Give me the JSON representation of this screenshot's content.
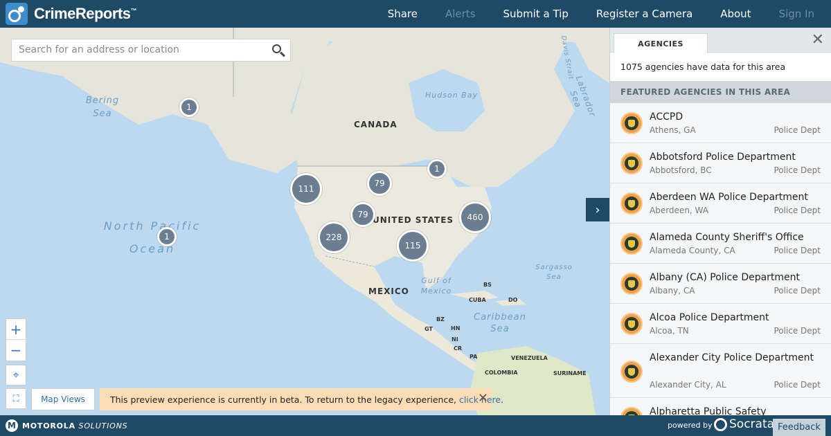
{
  "header": {
    "logo_text": "CrimeReports",
    "logo_tm": "™",
    "nav": [
      {
        "label": "Share",
        "enabled": true
      },
      {
        "label": "Alerts",
        "enabled": false
      },
      {
        "label": "Submit a Tip",
        "enabled": true
      },
      {
        "label": "Register a Camera",
        "enabled": true
      },
      {
        "label": "About",
        "enabled": true
      },
      {
        "label": "Sign In",
        "enabled": false
      }
    ]
  },
  "search": {
    "placeholder": "Search for an address or location"
  },
  "map": {
    "clusters": [
      "1",
      "1",
      "111",
      "79",
      "79",
      "228",
      "115",
      "460",
      "1"
    ],
    "labels": {
      "canada": "CANADA",
      "united_states": "UNITED STATES",
      "mexico": "MEXICO",
      "cuba": "CUBA",
      "bs": "BS",
      "do": "DO",
      "bz": "BZ",
      "gt": "GT",
      "hn": "HN",
      "ni": "NI",
      "cr": "CR",
      "pa": "PA",
      "venezuela": "VENEZUELA",
      "colombia": "COLOMBIA",
      "suriname": "SURINAME"
    },
    "oceans": {
      "north_pacific_1": "North Pacific",
      "north_pacific_2": "Ocean",
      "bering_1": "Bering",
      "bering_2": "Sea",
      "hudson": "Hudson Bay",
      "labrador_1": "Labrador",
      "labrador_2": "Sea",
      "davis": "Davis Strait",
      "gulf_1": "Gulf of",
      "gulf_2": "Mexico",
      "caribbean_1": "Caribbean",
      "caribbean_2": "Sea",
      "sargasso_1": "Sargasso",
      "sargasso_2": "Sea"
    },
    "map_views": "Map Views",
    "zoom_in": "+",
    "zoom_out": "−"
  },
  "beta_notice": {
    "text": "This preview experience is currently in beta. To return to the legacy experience,",
    "link": "click here",
    "period": "."
  },
  "panel": {
    "tab": "AGENCIES",
    "count_text": "1075 agencies have data for this area",
    "featured_header": "FEATURED AGENCIES IN THIS AREA",
    "agencies": [
      {
        "name": "ACCPD",
        "location": "Athens, GA",
        "type": "Police Dept"
      },
      {
        "name": "Abbotsford Police Department",
        "location": "Abbotsford, BC",
        "type": "Police Dept"
      },
      {
        "name": "Aberdeen WA Police Department",
        "location": "Aberdeen, WA",
        "type": "Police Dept"
      },
      {
        "name": "Alameda County Sheriff's Office",
        "location": "Alameda County, CA",
        "type": "Police Dept"
      },
      {
        "name": "Albany (CA) Police Department",
        "location": "Albany, CA",
        "type": "Police Dept"
      },
      {
        "name": "Alcoa Police Department",
        "location": "Alcoa, TN",
        "type": "Police Dept"
      },
      {
        "name": "Alexander City Police Department",
        "location": "Alexander City, AL",
        "type": "Police Dept"
      },
      {
        "name": "Alpharetta Public Safety",
        "location": "",
        "type": ""
      }
    ]
  },
  "footer": {
    "brand_bold": "MOTOROLA",
    "brand_italic": "SOLUTIONS",
    "powered_by": "powered by",
    "socrata": "Socrata",
    "feedback": "Feedback"
  },
  "colors": {
    "header_bg": "#1f4a66",
    "cluster": "#6b7d90",
    "beta_bg": "#fcdcb4",
    "badge": "#efa24c"
  }
}
